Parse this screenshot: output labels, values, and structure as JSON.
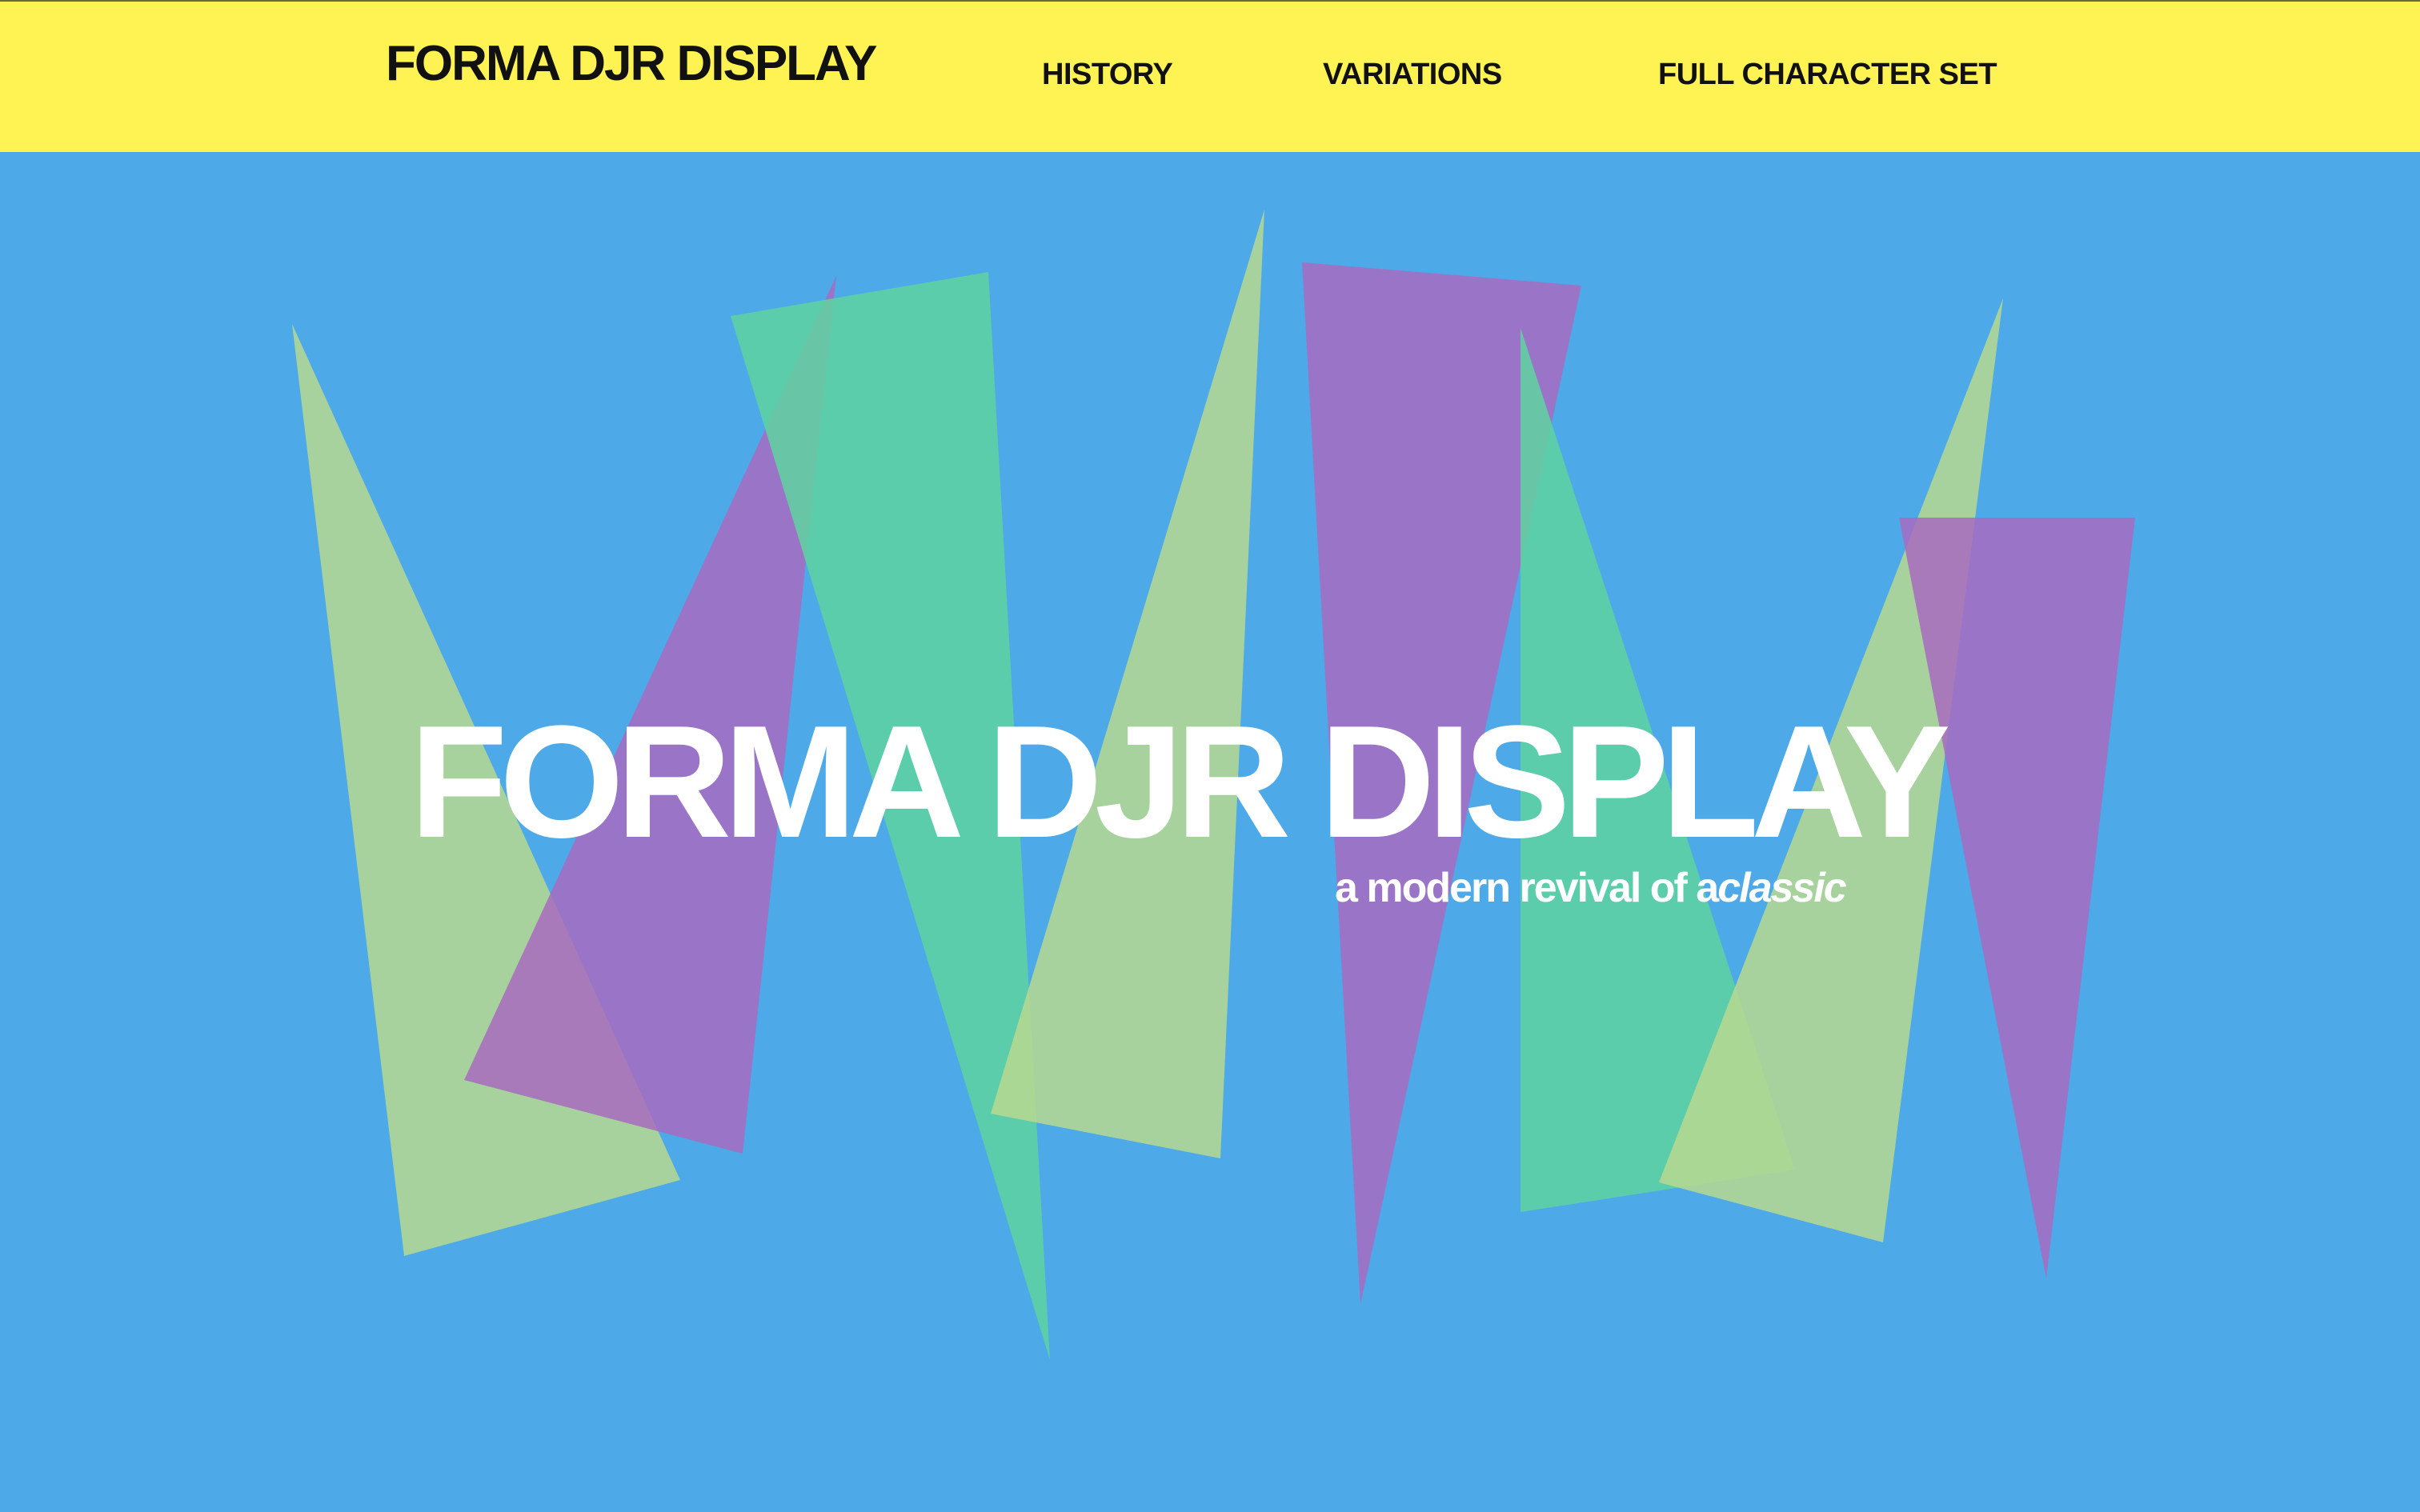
{
  "header": {
    "brand": "FORMA DJR DISPLAY",
    "nav": [
      {
        "label": "HISTORY"
      },
      {
        "label": "VARIATIONS"
      },
      {
        "label": "FULL CHARACTER SET"
      }
    ]
  },
  "hero": {
    "title": "FORMA DJR DISPLAY",
    "subtitle_main": "a modern revival of a",
    "subtitle_emphasis": "classic"
  },
  "colors": {
    "header_bg": "#FEF352",
    "page_bg": "#4DA9E7",
    "shape_sage": "#B7D98F",
    "shape_purple": "#A86BC0",
    "shape_green": "#5FD3A0"
  }
}
